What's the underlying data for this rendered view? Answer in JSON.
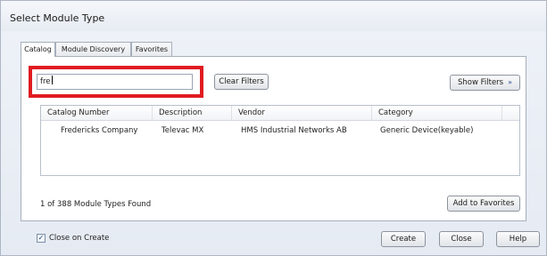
{
  "window": {
    "title": "Select Module Type"
  },
  "tabs": [
    {
      "label": "Catalog",
      "active": true
    },
    {
      "label": "Module Discovery",
      "active": false
    },
    {
      "label": "Favorites",
      "active": false
    }
  ],
  "search": {
    "value": "fre"
  },
  "buttons": {
    "clear_filters": "Clear Filters",
    "show_filters": "Show Filters",
    "add_to_favorites": "Add to Favorites",
    "create": "Create",
    "close": "Close",
    "help": "Help"
  },
  "icons": {
    "show_filters": "double-chevron-down-icon",
    "checkbox": "check-icon"
  },
  "table": {
    "columns": [
      "Catalog Number",
      "Description",
      "Vendor",
      "Category"
    ],
    "rows": [
      [
        "Fredericks Company",
        "Televac MX",
        "HMS Industrial Networks AB",
        "Generic Device(keyable)"
      ]
    ]
  },
  "status": {
    "count_text": "1 of 388 Module Types Found"
  },
  "options": {
    "close_on_create_label": "Close on Create",
    "close_on_create_checked": true
  },
  "colors": {
    "highlight": "#e01b22"
  }
}
